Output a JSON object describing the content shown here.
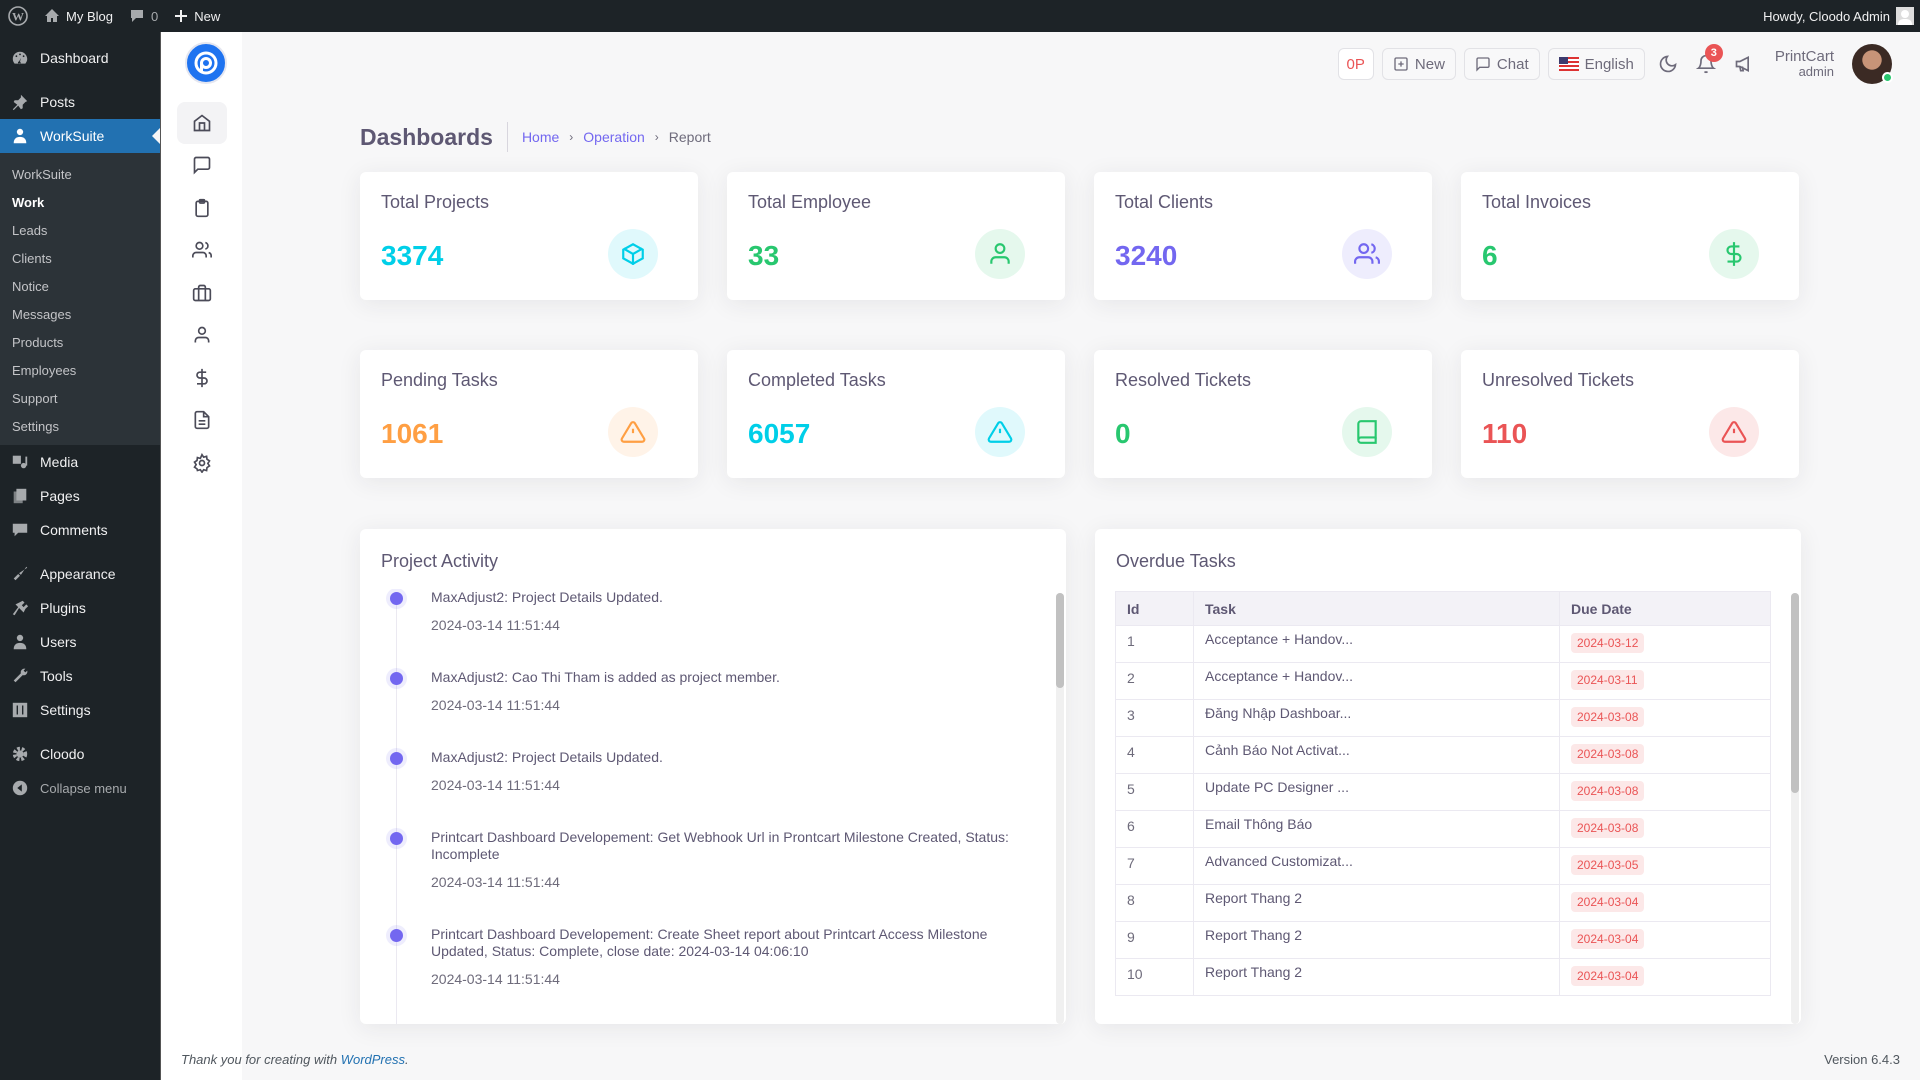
{
  "adminbar": {
    "site_name": "My Blog",
    "comments_count": "0",
    "new_label": "New",
    "howdy": "Howdy, Cloodo Admin"
  },
  "wp_menu": {
    "top": [
      {
        "label": "Dashboard",
        "icon": "dashboard-icon"
      },
      {
        "label": "Posts",
        "icon": "pin-icon"
      }
    ],
    "active": {
      "label": "WorkSuite",
      "icon": "user-icon"
    },
    "submenu": [
      "WorkSuite",
      "Work",
      "Leads",
      "Clients",
      "Notice",
      "Messages",
      "Products",
      "Employees",
      "Support",
      "Settings"
    ],
    "current_sub": "Work",
    "group2": [
      {
        "label": "Media",
        "icon": "media-icon"
      },
      {
        "label": "Pages",
        "icon": "pages-icon"
      },
      {
        "label": "Comments",
        "icon": "comments-icon"
      }
    ],
    "group3": [
      {
        "label": "Appearance",
        "icon": "brush-icon"
      },
      {
        "label": "Plugins",
        "icon": "plug-icon"
      },
      {
        "label": "Users",
        "icon": "users-icon"
      },
      {
        "label": "Tools",
        "icon": "wrench-icon"
      },
      {
        "label": "Settings",
        "icon": "settings-icon"
      }
    ],
    "group4": [
      {
        "label": "Cloodo",
        "icon": "gear-icon"
      }
    ],
    "collapse": "Collapse menu"
  },
  "header": {
    "op_label": "0P",
    "new_label": "New",
    "chat_label": "Chat",
    "language": "English",
    "notifications": "3",
    "user_name": "PrintCart",
    "user_role": "admin"
  },
  "page": {
    "title": "Dashboards",
    "breadcrumb": [
      "Home",
      "Operation",
      "Report"
    ]
  },
  "stats": [
    {
      "label": "Total Projects",
      "value": "3374",
      "color": "#00cfe8",
      "bg": "#e0f9fc",
      "icon": "cube-icon"
    },
    {
      "label": "Total Employee",
      "value": "33",
      "color": "#28c76f",
      "bg": "#e5f8ed",
      "icon": "user-icon"
    },
    {
      "label": "Total Clients",
      "value": "3240",
      "color": "#7367f0",
      "bg": "#eeedfd",
      "icon": "users-icon"
    },
    {
      "label": "Total Invoices",
      "value": "6",
      "color": "#28c76f",
      "bg": "#e5f8ed",
      "icon": "dollar-icon"
    },
    {
      "label": "Pending Tasks",
      "value": "1061",
      "color": "#ff9f43",
      "bg": "#fff3e8",
      "icon": "alert-triangle-icon"
    },
    {
      "label": "Completed Tasks",
      "value": "6057",
      "color": "#00cfe8",
      "bg": "#e0f9fc",
      "icon": "alert-triangle-icon"
    },
    {
      "label": "Resolved Tickets",
      "value": "0",
      "color": "#28c76f",
      "bg": "#e5f8ed",
      "icon": "book-icon"
    },
    {
      "label": "Unresolved Tickets",
      "value": "110",
      "color": "#ea5455",
      "bg": "#fce8e8",
      "icon": "alert-triangle-icon"
    }
  ],
  "activity": {
    "title": "Project Activity",
    "items": [
      {
        "text": "MaxAdjust2: Project Details Updated.",
        "time": "2024-03-14 11:51:44"
      },
      {
        "text": "MaxAdjust2: Cao Thi Tham is added as project member.",
        "time": "2024-03-14 11:51:44"
      },
      {
        "text": "MaxAdjust2: Project Details Updated.",
        "time": "2024-03-14 11:51:44"
      },
      {
        "text": "Printcart Dashboard Developement: Get Webhook Url in Prontcart Milestone Created, Status: Incomplete",
        "time": "2024-03-14 11:51:44"
      },
      {
        "text": "Printcart Dashboard Developement: Create Sheet report about Printcart Access Milestone Updated, Status: Complete, close date: 2024-03-14 04:06:10",
        "time": "2024-03-14 11:51:44"
      }
    ]
  },
  "overdue": {
    "title": "Overdue Tasks",
    "columns": [
      "Id",
      "Task",
      "Due Date"
    ],
    "rows": [
      {
        "id": "1",
        "task": "Acceptance + Handov...",
        "due": "2024-03-12"
      },
      {
        "id": "2",
        "task": "Acceptance + Handov...",
        "due": "2024-03-11"
      },
      {
        "id": "3",
        "task": "Đăng Nhập Dashboar...",
        "due": "2024-03-08"
      },
      {
        "id": "4",
        "task": "Cảnh Báo Not Activat...",
        "due": "2024-03-08"
      },
      {
        "id": "5",
        "task": "Update PC Designer ...",
        "due": "2024-03-08"
      },
      {
        "id": "6",
        "task": "Email Thông Báo",
        "due": "2024-03-08"
      },
      {
        "id": "7",
        "task": "Advanced Customizat...",
        "due": "2024-03-05"
      },
      {
        "id": "8",
        "task": "Report Thang 2",
        "due": "2024-03-04"
      },
      {
        "id": "9",
        "task": "Report Thang 2",
        "due": "2024-03-04"
      },
      {
        "id": "10",
        "task": "Report Thang 2",
        "due": "2024-03-04"
      }
    ]
  },
  "footer": {
    "thanks_prefix": "Thank you for creating with ",
    "wp_link": "WordPress",
    "thanks_suffix": ".",
    "version": "Version 6.4.3"
  }
}
